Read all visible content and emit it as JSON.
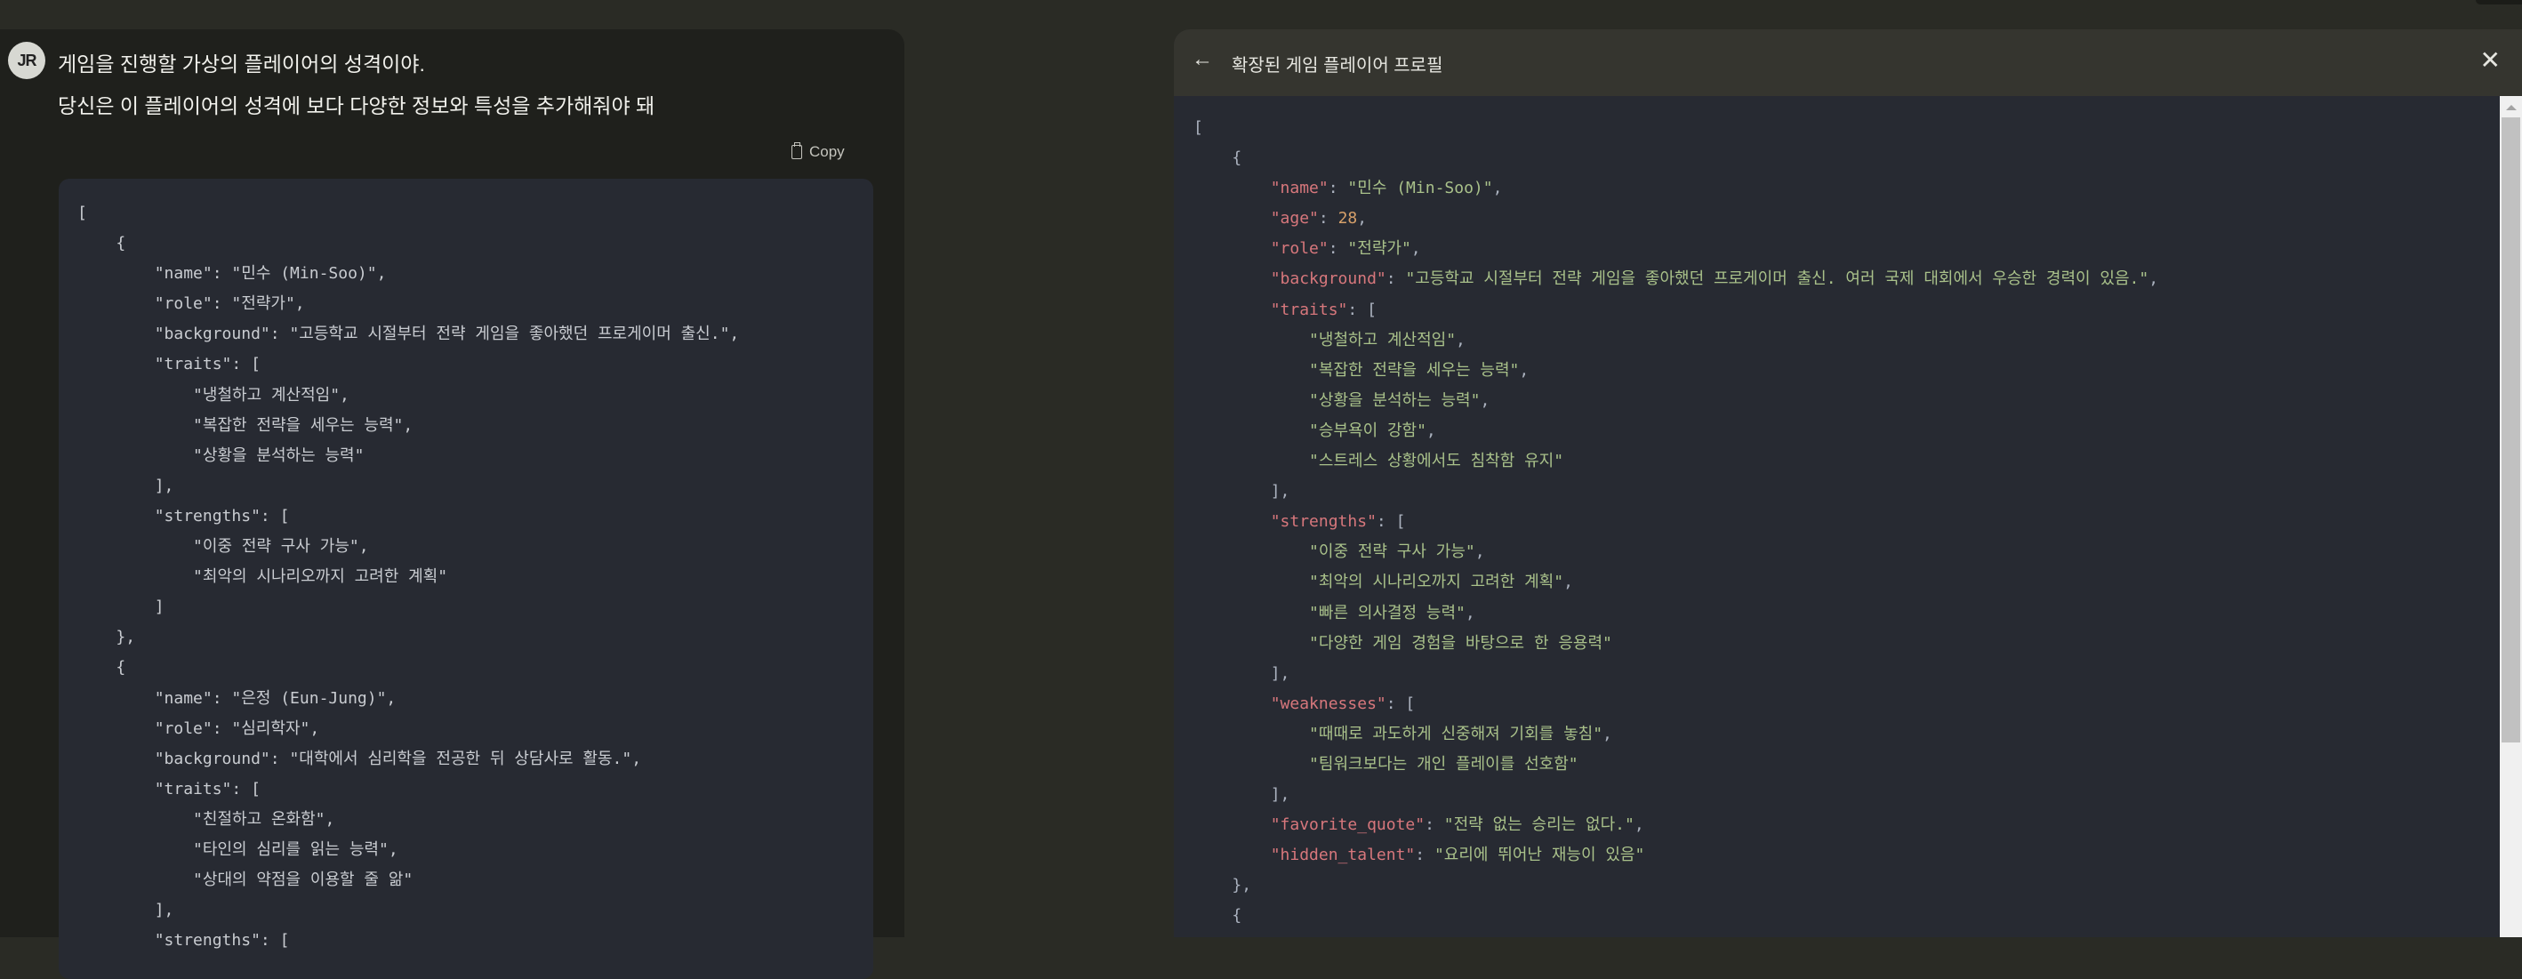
{
  "user_message": {
    "avatar_initials": "JR",
    "lines": [
      "게임을 진행할 가상의 플레이어의 성격이야.",
      "당신은 이 플레이어의 성격에 보다 다양한 정보와 특성을 추가해줘야 돼"
    ]
  },
  "copy_label": "Copy",
  "left_code": [
    [
      0,
      [
        [
          "punc",
          "["
        ]
      ]
    ],
    [
      1,
      [
        [
          "punc",
          "{"
        ]
      ]
    ],
    [
      2,
      [
        [
          "key",
          "\"name\""
        ],
        [
          "punc",
          ": "
        ],
        [
          "str",
          "\"민수 (Min-Soo)\""
        ],
        [
          "punc",
          ","
        ]
      ]
    ],
    [
      2,
      [
        [
          "key",
          "\"role\""
        ],
        [
          "punc",
          ": "
        ],
        [
          "str",
          "\"전략가\""
        ],
        [
          "punc",
          ","
        ]
      ]
    ],
    [
      2,
      [
        [
          "key",
          "\"background\""
        ],
        [
          "punc",
          ": "
        ],
        [
          "str",
          "\"고등학교 시절부터 전략 게임을 좋아했던 프로게이머 출신.\""
        ],
        [
          "punc",
          ","
        ]
      ]
    ],
    [
      2,
      [
        [
          "key",
          "\"traits\""
        ],
        [
          "punc",
          ": ["
        ]
      ]
    ],
    [
      3,
      [
        [
          "str",
          "\"냉철하고 계산적임\""
        ],
        [
          "punc",
          ","
        ]
      ]
    ],
    [
      3,
      [
        [
          "str",
          "\"복잡한 전략을 세우는 능력\""
        ],
        [
          "punc",
          ","
        ]
      ]
    ],
    [
      3,
      [
        [
          "str",
          "\"상황을 분석하는 능력\""
        ]
      ]
    ],
    [
      2,
      [
        [
          "punc",
          "],"
        ]
      ]
    ],
    [
      2,
      [
        [
          "key",
          "\"strengths\""
        ],
        [
          "punc",
          ": ["
        ]
      ]
    ],
    [
      3,
      [
        [
          "str",
          "\"이중 전략 구사 가능\""
        ],
        [
          "punc",
          ","
        ]
      ]
    ],
    [
      3,
      [
        [
          "str",
          "\"최악의 시나리오까지 고려한 계획\""
        ]
      ]
    ],
    [
      2,
      [
        [
          "punc",
          "]"
        ]
      ]
    ],
    [
      1,
      [
        [
          "punc",
          "},"
        ]
      ]
    ],
    [
      1,
      [
        [
          "punc",
          "{"
        ]
      ]
    ],
    [
      2,
      [
        [
          "key",
          "\"name\""
        ],
        [
          "punc",
          ": "
        ],
        [
          "str",
          "\"은정 (Eun-Jung)\""
        ],
        [
          "punc",
          ","
        ]
      ]
    ],
    [
      2,
      [
        [
          "key",
          "\"role\""
        ],
        [
          "punc",
          ": "
        ],
        [
          "str",
          "\"심리학자\""
        ],
        [
          "punc",
          ","
        ]
      ]
    ],
    [
      2,
      [
        [
          "key",
          "\"background\""
        ],
        [
          "punc",
          ": "
        ],
        [
          "str",
          "\"대학에서 심리학을 전공한 뒤 상담사로 활동.\""
        ],
        [
          "punc",
          ","
        ]
      ]
    ],
    [
      2,
      [
        [
          "key",
          "\"traits\""
        ],
        [
          "punc",
          ": ["
        ]
      ]
    ],
    [
      3,
      [
        [
          "str",
          "\"친절하고 온화함\""
        ],
        [
          "punc",
          ","
        ]
      ]
    ],
    [
      3,
      [
        [
          "str",
          "\"타인의 심리를 읽는 능력\""
        ],
        [
          "punc",
          ","
        ]
      ]
    ],
    [
      3,
      [
        [
          "str",
          "\"상대의 약점을 이용할 줄 앎\""
        ]
      ]
    ],
    [
      2,
      [
        [
          "punc",
          "],"
        ]
      ]
    ],
    [
      2,
      [
        [
          "key",
          "\"strengths\""
        ],
        [
          "punc",
          ": ["
        ]
      ]
    ]
  ],
  "artifact": {
    "title": "확장된 게임 플레이어 프로필",
    "back_icon": "arrow-left-icon",
    "close_icon": "close-icon",
    "code": [
      [
        0,
        [
          [
            "punc",
            "["
          ]
        ]
      ],
      [
        1,
        [
          [
            "punc",
            "{"
          ]
        ]
      ],
      [
        2,
        [
          [
            "key",
            "\"name\""
          ],
          [
            "punc",
            ": "
          ],
          [
            "str",
            "\"민수 (Min-Soo)\""
          ],
          [
            "punc",
            ","
          ]
        ]
      ],
      [
        2,
        [
          [
            "key",
            "\"age\""
          ],
          [
            "punc",
            ": "
          ],
          [
            "num",
            "28"
          ],
          [
            "punc",
            ","
          ]
        ]
      ],
      [
        2,
        [
          [
            "key",
            "\"role\""
          ],
          [
            "punc",
            ": "
          ],
          [
            "str",
            "\"전략가\""
          ],
          [
            "punc",
            ","
          ]
        ]
      ],
      [
        2,
        [
          [
            "key",
            "\"background\""
          ],
          [
            "punc",
            ": "
          ],
          [
            "str",
            "\"고등학교 시절부터 전략 게임을 좋아했던 프로게이머 출신. 여러 국제 대회에서 우승한 경력이 있음.\""
          ],
          [
            "punc",
            ","
          ]
        ]
      ],
      [
        2,
        [
          [
            "key",
            "\"traits\""
          ],
          [
            "punc",
            ": ["
          ]
        ]
      ],
      [
        3,
        [
          [
            "str",
            "\"냉철하고 계산적임\""
          ],
          [
            "punc",
            ","
          ]
        ]
      ],
      [
        3,
        [
          [
            "str",
            "\"복잡한 전략을 세우는 능력\""
          ],
          [
            "punc",
            ","
          ]
        ]
      ],
      [
        3,
        [
          [
            "str",
            "\"상황을 분석하는 능력\""
          ],
          [
            "punc",
            ","
          ]
        ]
      ],
      [
        3,
        [
          [
            "str",
            "\"승부욕이 강함\""
          ],
          [
            "punc",
            ","
          ]
        ]
      ],
      [
        3,
        [
          [
            "str",
            "\"스트레스 상황에서도 침착함 유지\""
          ]
        ]
      ],
      [
        2,
        [
          [
            "punc",
            "],"
          ]
        ]
      ],
      [
        2,
        [
          [
            "key",
            "\"strengths\""
          ],
          [
            "punc",
            ": ["
          ]
        ]
      ],
      [
        3,
        [
          [
            "str",
            "\"이중 전략 구사 가능\""
          ],
          [
            "punc",
            ","
          ]
        ]
      ],
      [
        3,
        [
          [
            "str",
            "\"최악의 시나리오까지 고려한 계획\""
          ],
          [
            "punc",
            ","
          ]
        ]
      ],
      [
        3,
        [
          [
            "str",
            "\"빠른 의사결정 능력\""
          ],
          [
            "punc",
            ","
          ]
        ]
      ],
      [
        3,
        [
          [
            "str",
            "\"다양한 게임 경험을 바탕으로 한 응용력\""
          ]
        ]
      ],
      [
        2,
        [
          [
            "punc",
            "],"
          ]
        ]
      ],
      [
        2,
        [
          [
            "key",
            "\"weaknesses\""
          ],
          [
            "punc",
            ": ["
          ]
        ]
      ],
      [
        3,
        [
          [
            "str",
            "\"때때로 과도하게 신중해져 기회를 놓침\""
          ],
          [
            "punc",
            ","
          ]
        ]
      ],
      [
        3,
        [
          [
            "str",
            "\"팀워크보다는 개인 플레이를 선호함\""
          ]
        ]
      ],
      [
        2,
        [
          [
            "punc",
            "],"
          ]
        ]
      ],
      [
        2,
        [
          [
            "key",
            "\"favorite_quote\""
          ],
          [
            "punc",
            ": "
          ],
          [
            "str",
            "\"전략 없는 승리는 없다.\""
          ],
          [
            "punc",
            ","
          ]
        ]
      ],
      [
        2,
        [
          [
            "key",
            "\"hidden_talent\""
          ],
          [
            "punc",
            ": "
          ],
          [
            "str",
            "\"요리에 뛰어난 재능이 있음\""
          ]
        ]
      ],
      [
        1,
        [
          [
            "punc",
            "},"
          ]
        ]
      ],
      [
        1,
        [
          [
            "punc",
            "{"
          ]
        ]
      ]
    ]
  },
  "colors": {
    "key": "#d7777c",
    "string": "#a9c18a",
    "number": "#d6a06a",
    "punctuation": "#abb2bf",
    "code_bg": "#272a32"
  }
}
